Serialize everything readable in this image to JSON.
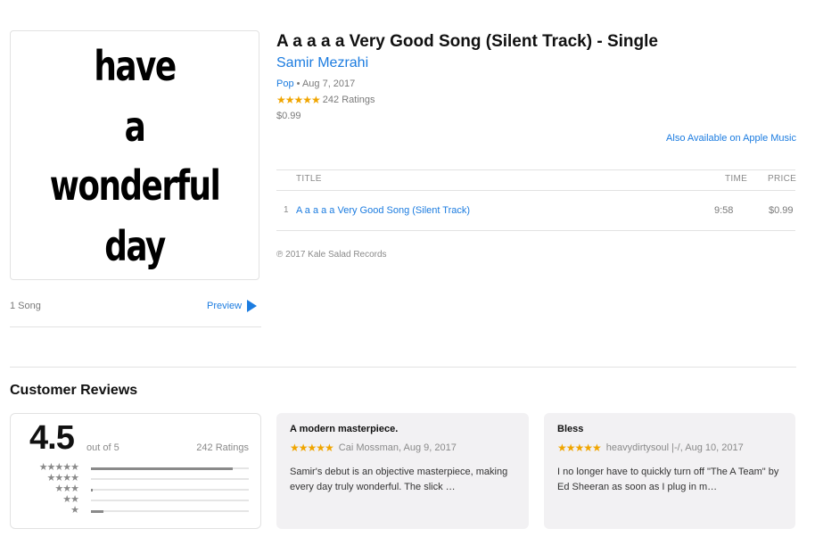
{
  "album": {
    "artwork_lines": [
      "have",
      "a",
      "wonderful",
      "day"
    ],
    "title": "A a a a a Very Good Song (Silent Track) - Single",
    "artist": "Samir Mezrahi",
    "genre": "Pop",
    "separator": "•",
    "release_date": "Aug 7, 2017",
    "rating_stars": "★★★★★",
    "ratings_count": "242 Ratings",
    "price": "$0.99",
    "apple_music_link": "Also Available on Apple Music",
    "song_count": "1 Song",
    "preview_label": "Preview",
    "copyright": "℗ 2017 Kale Salad Records"
  },
  "tracklist": {
    "headers": {
      "title": "TITLE",
      "time": "TIME",
      "price": "PRICE"
    },
    "tracks": [
      {
        "number": "1",
        "name": "A a a a a Very Good Song (Silent Track)",
        "time": "9:58",
        "price": "$0.99"
      }
    ]
  },
  "reviews": {
    "heading": "Customer Reviews",
    "summary": {
      "score": "4.5",
      "out_of": "out of 5",
      "count": "242 Ratings",
      "breakdown": [
        {
          "stars": "★★★★★",
          "fraction": 0.9
        },
        {
          "stars": "★★★★",
          "fraction": 0.0
        },
        {
          "stars": "★★★",
          "fraction": 0.01
        },
        {
          "stars": "★★",
          "fraction": 0.0
        },
        {
          "stars": "★",
          "fraction": 0.08
        }
      ]
    },
    "items": [
      {
        "title": "A modern masterpiece.",
        "stars": "★★★★★",
        "byline": "Cai Mossman, Aug 9, 2017",
        "text": "Samir's debut is an objective masterpiece, making every day truly wonderful. The slick …"
      },
      {
        "title": "Bless",
        "stars": "★★★★★",
        "byline": "heavydirtysoul |-/, Aug 10, 2017",
        "text": "I no longer have to quickly turn off \"The A Team\" by Ed Sheeran as soon as I plug in m…"
      }
    ]
  },
  "colors": {
    "link": "#1c7ce0",
    "star": "#f0a500",
    "muted": "#8a8a8a",
    "card_bg": "#f2f1f3"
  },
  "icons": {
    "preview": "play-icon"
  }
}
